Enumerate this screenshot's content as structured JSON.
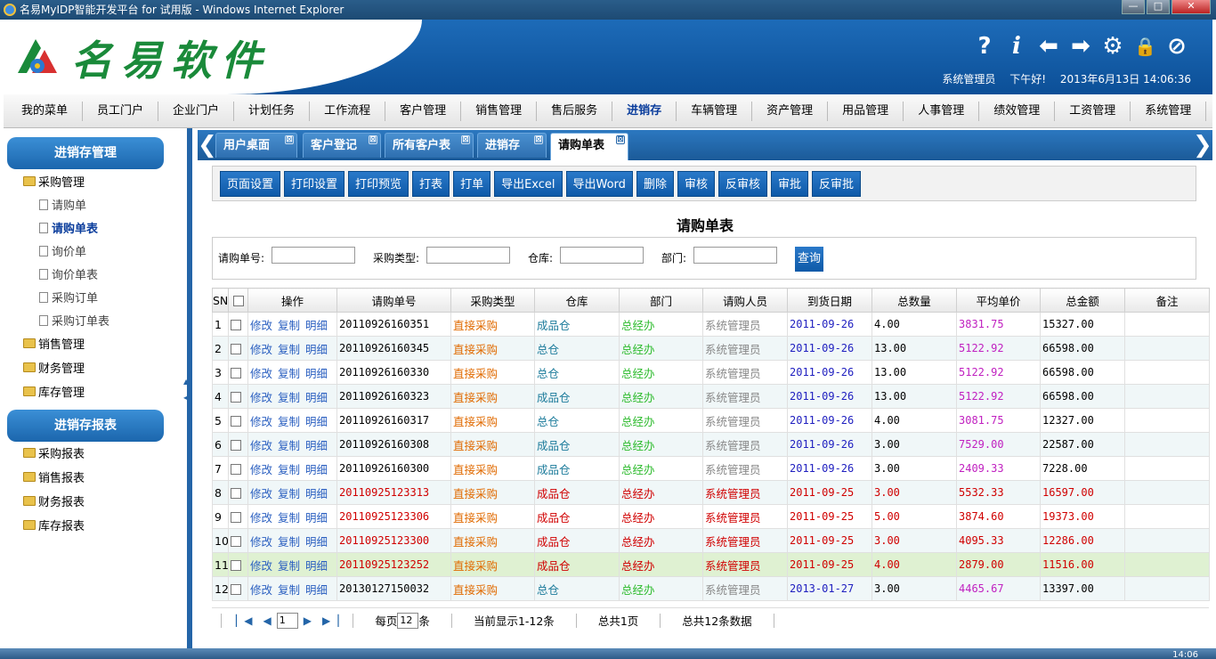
{
  "window": {
    "title": "名易MyIDP智能开发平台 for 试用版 - Windows Internet Explorer",
    "btn_min": "—",
    "btn_max": "□",
    "btn_close": "✕"
  },
  "header": {
    "brand": "名易软件",
    "user": "系统管理员",
    "greeting": "下午好!",
    "datetime": "2013年6月13日 14:06:36",
    "icons": {
      "help": "?",
      "info": "i",
      "back": "⬅",
      "forward": "➡",
      "settings": "⚙",
      "lock": "🔒",
      "exit": "⊘"
    }
  },
  "menu": [
    "我的菜单",
    "员工门户",
    "企业门户",
    "计划任务",
    "工作流程",
    "客户管理",
    "销售管理",
    "售后服务",
    "进销存",
    "车辆管理",
    "资产管理",
    "用品管理",
    "人事管理",
    "绩效管理",
    "工资管理",
    "系统管理"
  ],
  "menu_active": "进销存",
  "sidebar": {
    "section1": "进销存管理",
    "purchase": "采购管理",
    "purchase_items": [
      "请购单",
      "请购单表",
      "询价单",
      "询价单表",
      "采购订单",
      "采购订单表"
    ],
    "selected": "请购单表",
    "others1": [
      "销售管理",
      "财务管理",
      "库存管理"
    ],
    "section2": "进销存报表",
    "reports": [
      "采购报表",
      "销售报表",
      "财务报表",
      "库存报表"
    ],
    "arrow_up": "▲",
    "arrow_down": "◀"
  },
  "tabs": [
    {
      "label": "用户桌面"
    },
    {
      "label": "客户登记"
    },
    {
      "label": "所有客户表"
    },
    {
      "label": "进销存"
    },
    {
      "label": "请购单表"
    }
  ],
  "tab_close": "⊠",
  "tab_prev": "❮",
  "tab_next": "❯",
  "toolbar": [
    "页面设置",
    "打印设置",
    "打印预览",
    "打表",
    "打单",
    "导出Excel",
    "导出Word",
    "删除",
    "审核",
    "反审核",
    "审批",
    "反审批"
  ],
  "page_title": "请购单表",
  "search": {
    "f1": "请购单号:",
    "f2": "采购类型:",
    "f3": "仓库:",
    "f4": "部门:",
    "btn": "查询"
  },
  "table": {
    "headers": [
      "SN",
      "",
      "操作",
      "请购单号",
      "采购类型",
      "仓库",
      "部门",
      "请购人员",
      "到货日期",
      "总数量",
      "平均单价",
      "总金额",
      "备注"
    ],
    "ops": [
      "修改",
      "复制",
      "明细"
    ],
    "rows": [
      {
        "sn": "1",
        "no": "20110926160351",
        "type": "直接采购",
        "wh": "成品仓",
        "dept": "总经办",
        "person": "系统管理员",
        "date": "2011-09-26",
        "qty": "4.00",
        "price": "3831.75",
        "amount": "15327.00",
        "red": false
      },
      {
        "sn": "2",
        "no": "20110926160345",
        "type": "直接采购",
        "wh": "总仓",
        "dept": "总经办",
        "person": "系统管理员",
        "date": "2011-09-26",
        "qty": "13.00",
        "price": "5122.92",
        "amount": "66598.00",
        "red": false
      },
      {
        "sn": "3",
        "no": "20110926160330",
        "type": "直接采购",
        "wh": "总仓",
        "dept": "总经办",
        "person": "系统管理员",
        "date": "2011-09-26",
        "qty": "13.00",
        "price": "5122.92",
        "amount": "66598.00",
        "red": false
      },
      {
        "sn": "4",
        "no": "20110926160323",
        "type": "直接采购",
        "wh": "成品仓",
        "dept": "总经办",
        "person": "系统管理员",
        "date": "2011-09-26",
        "qty": "13.00",
        "price": "5122.92",
        "amount": "66598.00",
        "red": false
      },
      {
        "sn": "5",
        "no": "20110926160317",
        "type": "直接采购",
        "wh": "总仓",
        "dept": "总经办",
        "person": "系统管理员",
        "date": "2011-09-26",
        "qty": "4.00",
        "price": "3081.75",
        "amount": "12327.00",
        "red": false
      },
      {
        "sn": "6",
        "no": "20110926160308",
        "type": "直接采购",
        "wh": "成品仓",
        "dept": "总经办",
        "person": "系统管理员",
        "date": "2011-09-26",
        "qty": "3.00",
        "price": "7529.00",
        "amount": "22587.00",
        "red": false
      },
      {
        "sn": "7",
        "no": "20110926160300",
        "type": "直接采购",
        "wh": "成品仓",
        "dept": "总经办",
        "person": "系统管理员",
        "date": "2011-09-26",
        "qty": "3.00",
        "price": "2409.33",
        "amount": "7228.00",
        "red": false
      },
      {
        "sn": "8",
        "no": "20110925123313",
        "type": "直接采购",
        "wh": "成品仓",
        "dept": "总经办",
        "person": "系统管理员",
        "date": "2011-09-25",
        "qty": "3.00",
        "price": "5532.33",
        "amount": "16597.00",
        "red": true
      },
      {
        "sn": "9",
        "no": "20110925123306",
        "type": "直接采购",
        "wh": "成品仓",
        "dept": "总经办",
        "person": "系统管理员",
        "date": "2011-09-25",
        "qty": "5.00",
        "price": "3874.60",
        "amount": "19373.00",
        "red": true
      },
      {
        "sn": "10",
        "no": "20110925123300",
        "type": "直接采购",
        "wh": "成品仓",
        "dept": "总经办",
        "person": "系统管理员",
        "date": "2011-09-25",
        "qty": "3.00",
        "price": "4095.33",
        "amount": "12286.00",
        "red": true
      },
      {
        "sn": "11",
        "no": "20110925123252",
        "type": "直接采购",
        "wh": "成品仓",
        "dept": "总经办",
        "person": "系统管理员",
        "date": "2011-09-25",
        "qty": "4.00",
        "price": "2879.00",
        "amount": "11516.00",
        "red": true
      },
      {
        "sn": "12",
        "no": "20130127150032",
        "type": "直接采购",
        "wh": "总仓",
        "dept": "总经办",
        "person": "系统管理员",
        "date": "2013-01-27",
        "qty": "3.00",
        "price": "4465.67",
        "amount": "13397.00",
        "red": false
      }
    ]
  },
  "pager": {
    "first": "▏◀",
    "prev": "◀",
    "page": "1",
    "next": "▶",
    "last": "▶▕",
    "per_page_prefix": "每页",
    "per_page": "12",
    "per_page_suffix": "条",
    "showing": "当前显示1-12条",
    "total_pages": "总共1页",
    "total_records": "总共12条数据"
  },
  "taskbar": {
    "clock": "14:06"
  }
}
